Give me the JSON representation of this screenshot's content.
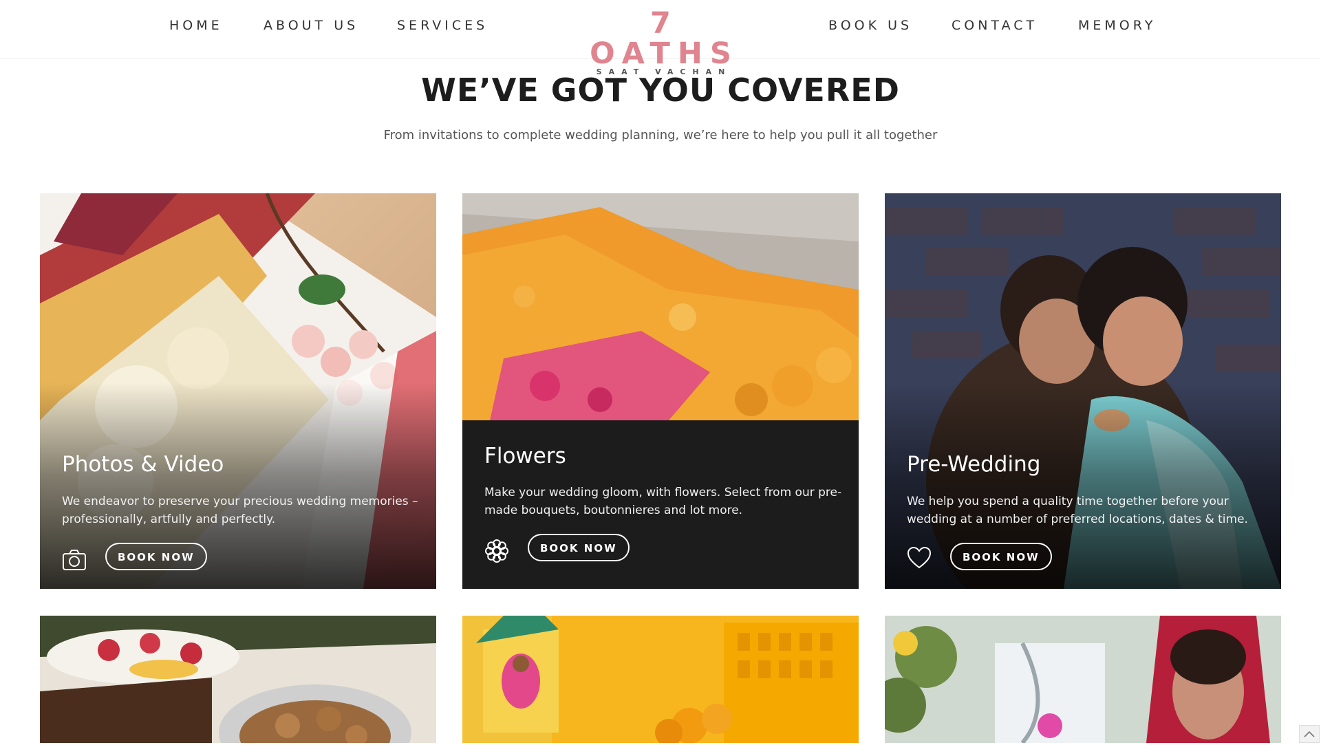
{
  "nav": {
    "left_items": [
      {
        "label": "HOME"
      },
      {
        "label": "ABOUT US"
      },
      {
        "label": "SERVICES"
      }
    ],
    "right_items": [
      {
        "label": "BOOK US"
      },
      {
        "label": "CONTACT"
      },
      {
        "label": "MEMORY"
      }
    ]
  },
  "logo": {
    "main": "7 OATHS",
    "sub": "SAAT VACHAN",
    "color": "#e0848f"
  },
  "intro": {
    "headline": "WE’VE GOT YOU COVERED",
    "subheadline": "From invitations to complete wedding planning, we’re here to help you pull it all together"
  },
  "services": [
    {
      "title": "Photos & Video",
      "description": "We endeavor to preserve your precious wedding memories – professionally, artfully and perfectly.",
      "icon": "camera-icon",
      "button": "BOOK NOW"
    },
    {
      "title": "Flowers",
      "description": "Make your wedding gloom, with flowers. Select from our pre-made bouquets, boutonnieres and lot more.",
      "icon": "flower-icon",
      "button": "BOOK NOW"
    },
    {
      "title": "Pre-Wedding",
      "description": "We help you spend a quality time together before your wedding at a number of preferred locations, dates & time.",
      "icon": "heart-icon",
      "button": "BOOK NOW"
    }
  ],
  "scroll_top": {
    "icon": "chevron-up-icon"
  },
  "colors": {
    "accent": "#e0848f",
    "panel": "#1c1c1c",
    "text": "#1f1f1f"
  }
}
